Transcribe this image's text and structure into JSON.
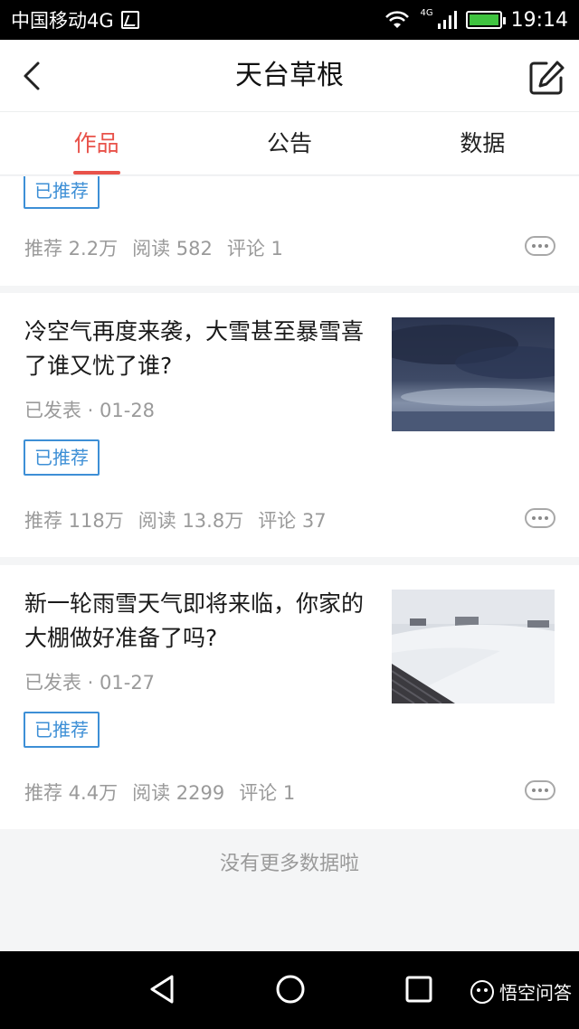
{
  "status_bar": {
    "carrier": "中国移动4G",
    "network_tag": "4G",
    "time": "19:14",
    "icons": [
      "sim-icon",
      "wifi-icon",
      "signal-icon",
      "battery-charging-icon"
    ]
  },
  "header": {
    "title": "天台草根",
    "back_icon": "chevron-left-icon",
    "edit_icon": "edit-icon"
  },
  "tabs": [
    {
      "label": "作品",
      "active": true
    },
    {
      "label": "公告",
      "active": false
    },
    {
      "label": "数据",
      "active": false
    }
  ],
  "articles": [
    {
      "title": "",
      "date": "",
      "badge": "已推荐",
      "stats": {
        "recommend": "推荐 2.2万",
        "read": "阅读 582",
        "comment": "评论 1"
      }
    },
    {
      "title": "冷空气再度来袭，大雪甚至暴雪喜了谁又忧了谁?",
      "date": "已发表 · 01-28",
      "badge": "已推荐",
      "stats": {
        "recommend": "推荐 118万",
        "read": "阅读 13.8万",
        "comment": "评论 37"
      },
      "thumbnail": "dark-cloudy-sky-image"
    },
    {
      "title": "新一轮雨雪天气即将来临，你家的大棚做好准备了吗?",
      "date": "已发表 · 01-27",
      "badge": "已推荐",
      "stats": {
        "recommend": "推荐 4.4万",
        "read": "阅读 2299",
        "comment": "评论 1"
      },
      "thumbnail": "snow-covered-greenhouse-image"
    }
  ],
  "footer_note": "没有更多数据啦",
  "nav_bar": {
    "icons": [
      "nav-back-icon",
      "nav-home-icon",
      "nav-recent-icon"
    ],
    "watermark": "悟空问答"
  },
  "colors": {
    "accent": "#e8524a",
    "badge": "#3d8fd6",
    "muted_text": "#9a9a9a",
    "page_bg": "#f4f5f6"
  }
}
